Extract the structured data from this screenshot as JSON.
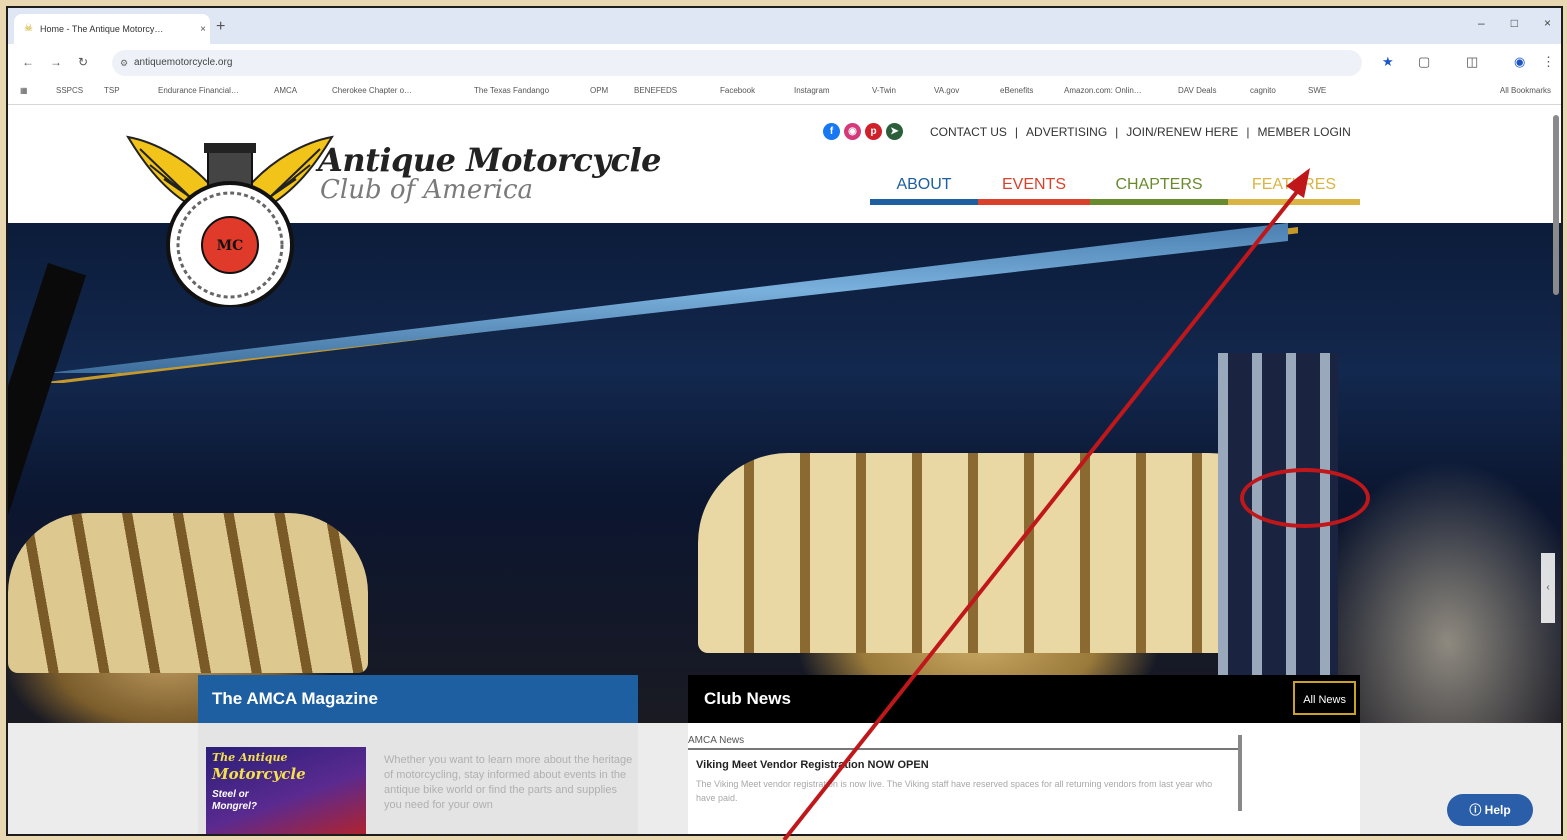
{
  "browser": {
    "tab_title": "Home - The Antique Motorcy…",
    "tab_close": "×",
    "new_tab": "+",
    "url": "antiquemotorcycle.org",
    "window_controls": [
      "–",
      "□",
      "×"
    ],
    "bookmarks": [
      "SSPCS",
      "TSP",
      "Endurance Financial…",
      "AMCA",
      "Cherokee Chapter o…",
      "The Texas Fandango",
      "OPM",
      "BENEFEDS",
      "Facebook",
      "Instagram",
      "V-Twin",
      "VA.gov",
      "eBenefits",
      "Amazon.com: Onlin…",
      "DAV Deals",
      "cagnito",
      "SWE"
    ],
    "all_bookmarks": "All Bookmarks"
  },
  "header": {
    "logo_title": "Antique Motorcycle",
    "logo_subtitle": "Club of America",
    "social_icons": [
      "facebook-icon",
      "instagram-icon",
      "pinterest-icon",
      "other-social-icon"
    ],
    "top_links": [
      "CONTACT US",
      "ADVERTISING",
      "JOIN/RENEW HERE",
      "MEMBER LOGIN"
    ],
    "nav": [
      {
        "label": "ABOUT",
        "color": "#1d5fa0"
      },
      {
        "label": "EVENTS",
        "color": "#d9412b"
      },
      {
        "label": "CHAPTERS",
        "color": "#6a8a2e"
      },
      {
        "label": "FEATURES",
        "color": "#d9b443"
      }
    ]
  },
  "magazine": {
    "heading": "The AMCA Magazine",
    "cover_line1": "The Antique",
    "cover_line2": "Motorcycle",
    "cover_line3": "Steel or Mongrel?",
    "text": "Whether you want to learn more about the heritage of motorcycling, stay informed about events in the antique bike world or find the parts and supplies you need for your own"
  },
  "news": {
    "heading": "Club News",
    "all_news": "All News",
    "category": "AMCA News",
    "item_title": "Viking Meet Vendor Registration NOW OPEN",
    "item_text": "The Viking Meet vendor registration is now live. The Viking staff have reserved spaces for all returning vendors from last year who have paid."
  },
  "help": {
    "label": "Help"
  },
  "colors": {
    "annotation_red": "#c0171b",
    "accent_gold": "#c9a227",
    "magazine_blue": "#1d5fa0"
  }
}
